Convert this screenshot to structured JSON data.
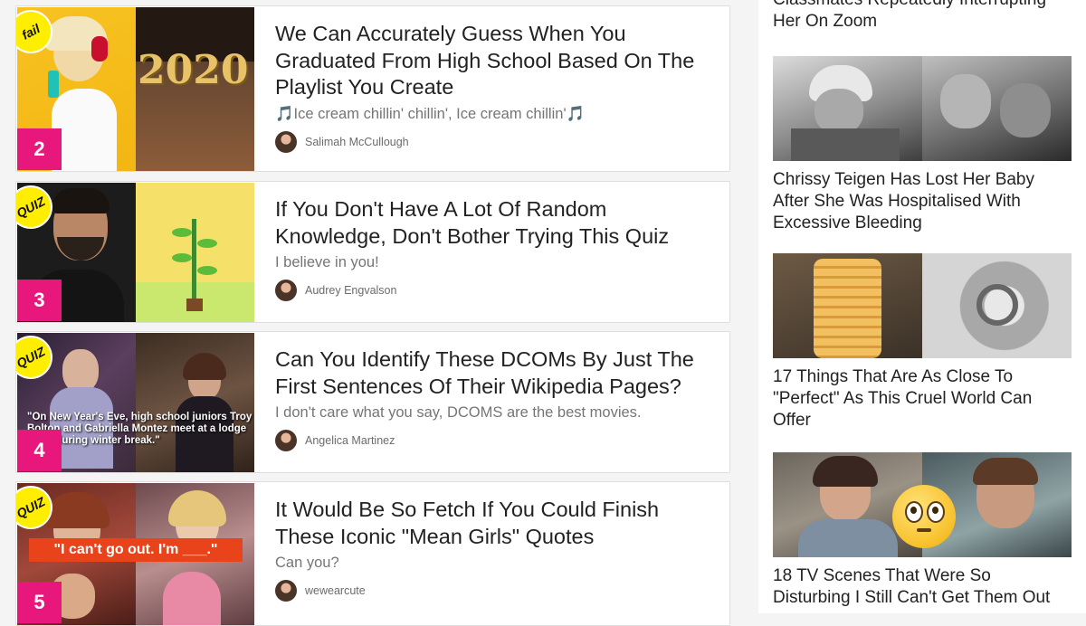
{
  "feed": {
    "cards": [
      {
        "rank": "2",
        "badge": "fail",
        "title": "We Can Accurately Guess When You Graduated From High School Based On The Playlist You Create",
        "description": "🎵Ice cream chillin' chillin', Ice cream chillin'🎵",
        "author": "Salimah McCullough",
        "thumb_text": "2020"
      },
      {
        "rank": "3",
        "badge": "QUIZ",
        "title": "If You Don't Have A Lot Of Random Knowledge, Don't Bother Trying This Quiz",
        "description": "I believe in you!",
        "author": "Audrey Engvalson"
      },
      {
        "rank": "4",
        "badge": "QUIZ",
        "title": "Can You Identify These DCOMs By Just The First Sentences Of Their Wikipedia Pages?",
        "description": "I don't care what you say, DCOMS are the best movies.",
        "author": "Angelica Martinez",
        "thumb_text": "\"On New Year's Eve, high school juniors Troy Bolton and Gabriella Montez meet at a lodge party during winter break.\""
      },
      {
        "rank": "5",
        "badge": "QUIZ",
        "title": "It Would Be So Fetch If You Could Finish These Iconic \"Mean Girls\" Quotes",
        "description": "Can you?",
        "author": "wewearcute",
        "thumb_text": "\"I can't go out. I'm ___.\""
      }
    ]
  },
  "sidebar": {
    "top_title": "Classmates Repeatedly Interrupting Her On Zoom",
    "items": [
      {
        "title": "Chrissy Teigen Has Lost Her Baby After She Was Hospitalised With Excessive Bleeding"
      },
      {
        "title": "17 Things That Are As Close To \"Perfect\" As This Cruel World Can Offer"
      },
      {
        "title": "18 TV Scenes That Were So Disturbing I Still Can't Get Them Out"
      }
    ]
  },
  "colors": {
    "rank_bg": "#e8177b",
    "badge_bg": "#ffee00"
  }
}
